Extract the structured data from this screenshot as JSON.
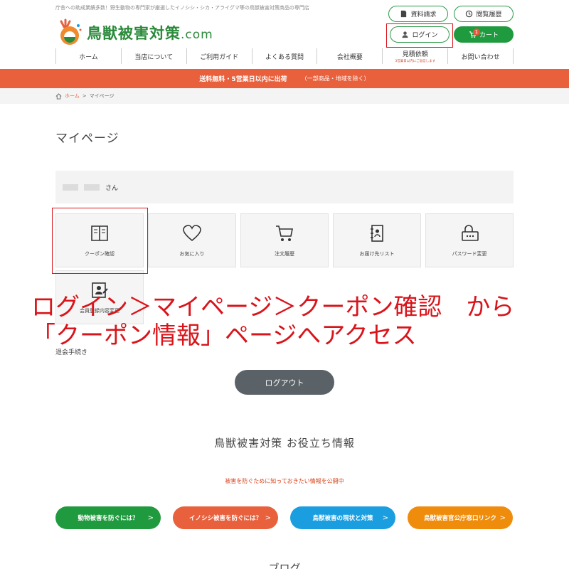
{
  "header": {
    "tagline": "庁舎への助成業績多数！野生動物の専門家が厳選したイノシシ・シカ・アライグマ等の鳥獣被害対策商品の専門店",
    "logo_text": "鳥獣被害対策",
    "logo_suffix": ".com",
    "buttons": {
      "request": "資料請求",
      "history": "閲覧履歴",
      "login": "ログイン",
      "cart": "カート",
      "cart_count": "1"
    }
  },
  "nav": {
    "items": [
      {
        "label": "ホーム",
        "sub": ""
      },
      {
        "label": "当店について",
        "sub": ""
      },
      {
        "label": "ご利用ガイド",
        "sub": ""
      },
      {
        "label": "よくある質問",
        "sub": ""
      },
      {
        "label": "会社概要",
        "sub": ""
      },
      {
        "label": "見積依頼",
        "sub": "3営業日以内にご返信します"
      },
      {
        "label": "お問い合わせ",
        "sub": ""
      }
    ]
  },
  "banner": {
    "main": "送料無料・5営業日以内に出荷",
    "note": "（一部商品・地域を除く）"
  },
  "breadcrumb": {
    "home": "ホーム",
    "sep": ">",
    "current": "マイページ"
  },
  "page": {
    "title": "マイページ",
    "user_suffix": "さん",
    "tiles": {
      "coupon": "クーポン確認",
      "favorites": "お気に入り",
      "orders": "注文履歴",
      "addresses": "お届け先リスト",
      "password": "パスワード変更",
      "profile": "会員登録内容変更"
    },
    "withdraw": "退会手続き",
    "logout": "ログアウト"
  },
  "annotation": {
    "text": "ログイン＞マイページ＞クーポン確認　から\n「クーポン情報」ページへアクセス"
  },
  "info": {
    "title": "鳥獣被害対策 お役立ち情報",
    "subtitle": "被害を防ぐために知っておきたい情報を公開中",
    "buttons": [
      {
        "label": "動物被害を防ぐには？"
      },
      {
        "label": "イノシシ被害を防ぐには？"
      },
      {
        "label": "鳥獣被害の現状と対策"
      },
      {
        "label": "鳥獣被害官公庁窓口リンク"
      }
    ],
    "arrow": ">"
  },
  "blog": {
    "title": "ブログ"
  },
  "colors": {
    "brand_green": "#1f9a3e",
    "accent_orange": "#e8603c",
    "annotation_red": "#d9141b",
    "info_blue": "#1a9ee0",
    "info_amber": "#ef8c0c",
    "logout_gray": "#5a6268"
  }
}
